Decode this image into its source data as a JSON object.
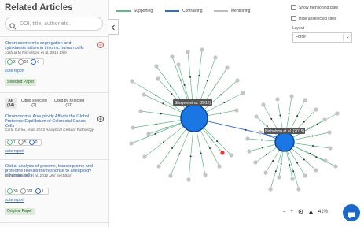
{
  "sidebar": {
    "title": "Related Articles",
    "search": {
      "placeholder": "DOI, title, author etc."
    },
    "articles": [
      {
        "title": "Chromosome mis-segregation and cytokinesis failure in trisomic human cells",
        "meta": "Joshua M Nicholson, et al. 2015",
        "journal": "Elife",
        "stats": [
          "2",
          "51",
          "0"
        ],
        "link": "scite report",
        "badge": "Selected Paper"
      },
      {
        "title": "Chromosomal Aneuploidy Affects the Global Proteome Equilibrium of Colorectal Cancer Cells",
        "meta": "Carla Gemo, et al. 2013",
        "journal": "Analytical Cellular Pathology",
        "stats": [
          "1",
          "5",
          "0"
        ],
        "link": "scite report"
      },
      {
        "title": "Global analysis of genome, transcriptome and proteome reveals the response to aneuploidy in human cells",
        "meta": "Silvia Stingele, et al. 2012",
        "journal": "Mol Syst Biol",
        "stats": [
          "30",
          "361",
          "1"
        ],
        "link": "scite report",
        "badge": "Original Paper"
      }
    ],
    "tabs": [
      {
        "label": "All",
        "count": "(34)"
      },
      {
        "label": "Citing selected",
        "count": "(2)"
      },
      {
        "label": "Cited by selected",
        "count": "(37)"
      }
    ]
  },
  "legend": [
    {
      "label": "Supporting",
      "color": "#5dbb86"
    },
    {
      "label": "Contrasting",
      "color": "#2b6fd6"
    },
    {
      "label": "Mentioning",
      "color": "#bdbdbd"
    }
  ],
  "options": {
    "show_mentioning": "Show mentioning cites",
    "hide_unselected": "Hide unselected cites",
    "layout_label": "Layout",
    "layout_value": "Force"
  },
  "graph": {
    "node_a_label": "Stingele et al. (2012)",
    "node_b_label": "Nicholson et al. (2015)",
    "colors": {
      "hub": "#1976e3",
      "leaf": "#c4c4c4",
      "highlight": "#e53935",
      "supporting": "#5dbb86",
      "contrasting": "#2b6fd6"
    }
  },
  "zoom": {
    "minus": "–",
    "plus": "+",
    "percent": "41%"
  }
}
